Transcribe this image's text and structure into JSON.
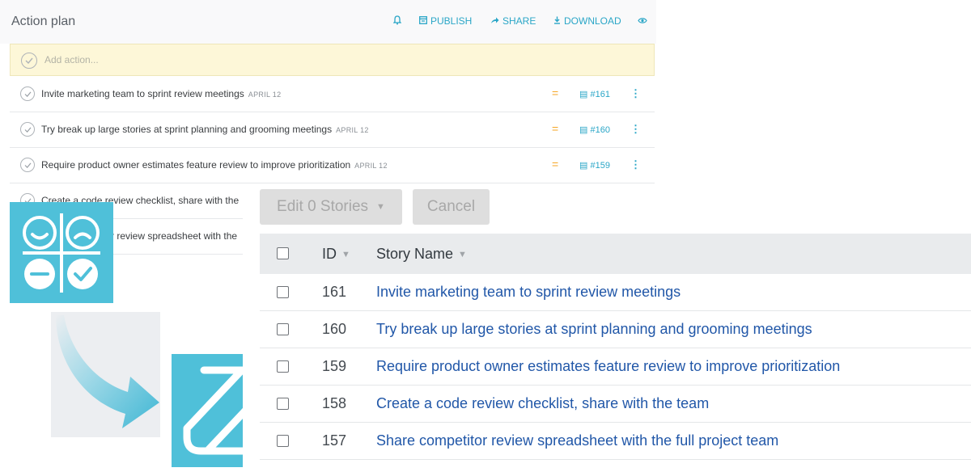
{
  "action_plan": {
    "title": "Action plan",
    "toolbar": {
      "publish": "PUBLISH",
      "share": "SHARE",
      "download": "DOWNLOAD"
    },
    "add_placeholder": "Add action...",
    "items": [
      {
        "text": "Invite marketing team to sprint review meetings",
        "date": "APRIL 12",
        "ref": "#161"
      },
      {
        "text": "Try break up large stories at sprint planning and grooming meetings",
        "date": "APRIL 12",
        "ref": "#160"
      },
      {
        "text": "Require product owner estimates feature review to improve prioritization",
        "date": "APRIL 12",
        "ref": "#159"
      },
      {
        "text": "Create a code review checklist, share with the",
        "date": "",
        "ref": ""
      },
      {
        "text": "r review spreadsheet with the",
        "date": "",
        "ref": ""
      }
    ]
  },
  "stories": {
    "edit_button": "Edit 0 Stories",
    "cancel_button": "Cancel",
    "columns": {
      "id": "ID",
      "name": "Story Name"
    },
    "rows": [
      {
        "id": "161",
        "name": "Invite marketing team to sprint review meetings"
      },
      {
        "id": "160",
        "name": "Try break up large stories at sprint planning and grooming meetings"
      },
      {
        "id": "159",
        "name": "Require product owner estimates feature review to improve prioritization"
      },
      {
        "id": "158",
        "name": "Create a code review checklist, share with the team"
      },
      {
        "id": "157",
        "name": "Share competitor review spreadsheet with the full project team"
      }
    ]
  },
  "colors": {
    "accent": "#2aa6c7",
    "logo": "#4fc0d9",
    "priority": "#f6a623",
    "story_link": "#2157a8"
  }
}
